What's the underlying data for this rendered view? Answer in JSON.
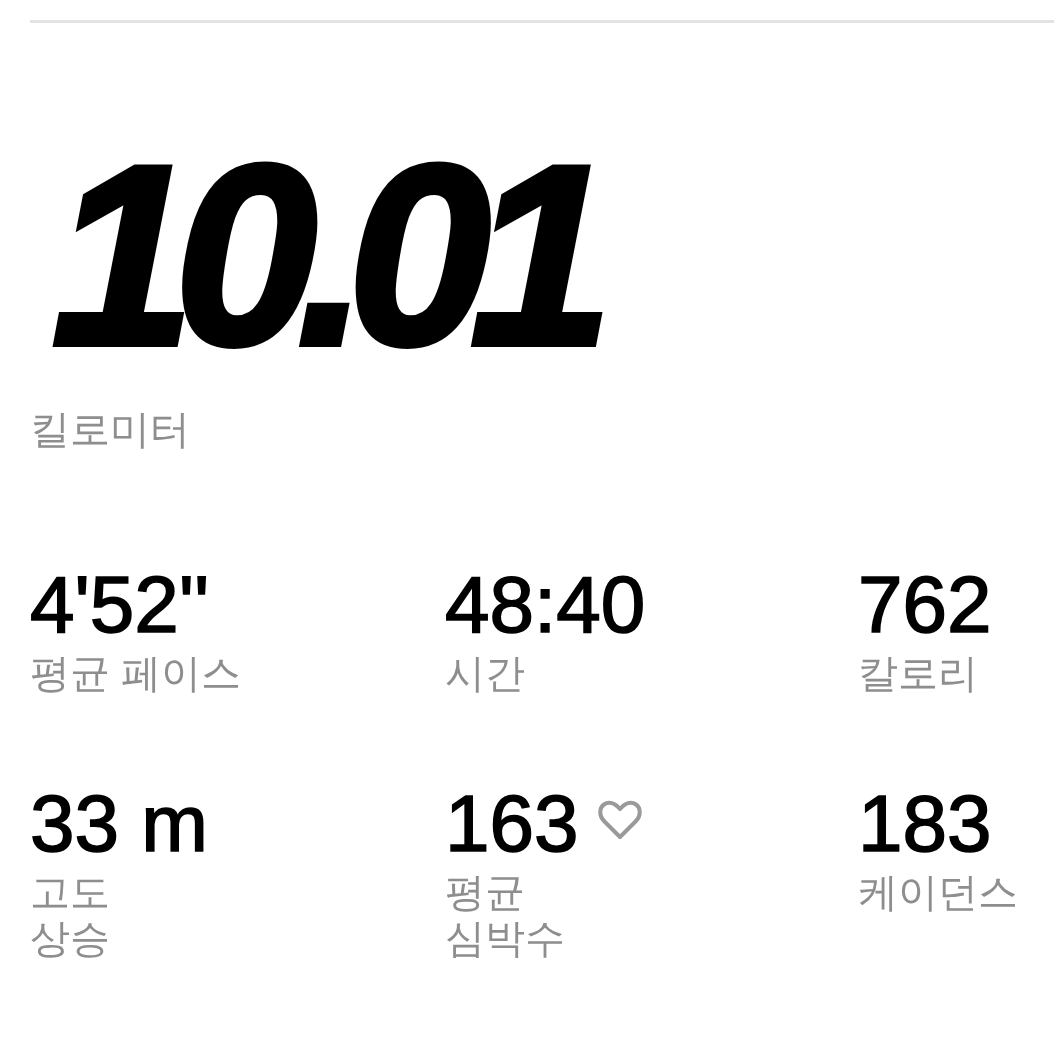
{
  "distance": {
    "value": "10.01",
    "unit": "킬로미터"
  },
  "stats": [
    {
      "kind": "plain",
      "value": "4'52''",
      "label": "평균 페이스"
    },
    {
      "kind": "plain",
      "value": "48:40",
      "label": "시간"
    },
    {
      "kind": "plain",
      "value": "762",
      "label": "칼로리"
    },
    {
      "kind": "plain",
      "value": "33 m",
      "label": "고도\n상승"
    },
    {
      "kind": "heart",
      "value": "163",
      "label": "평균\n심박수"
    },
    {
      "kind": "plain",
      "value": "183",
      "label": "케이던스"
    }
  ]
}
